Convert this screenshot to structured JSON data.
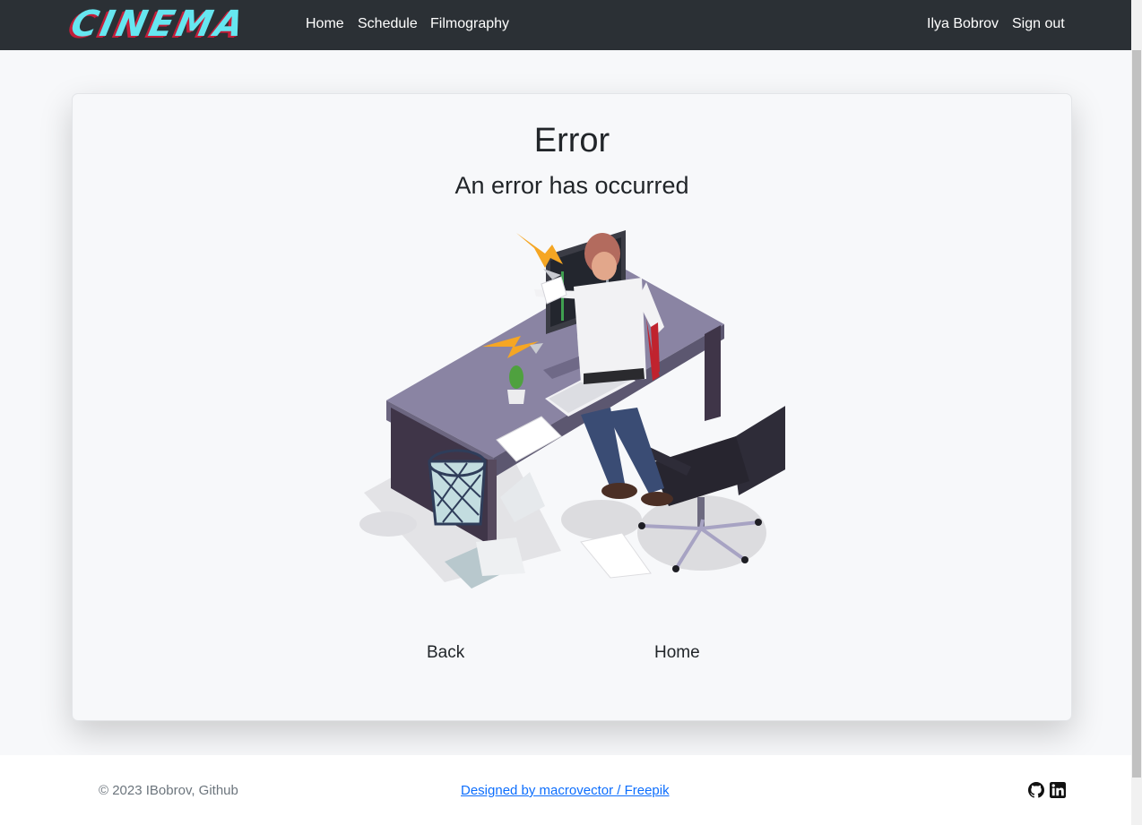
{
  "navbar": {
    "brand": "CINEMA",
    "links": [
      "Home",
      "Schedule",
      "Filmography"
    ],
    "user_name": "Ilya Bobrov",
    "sign_out": "Sign out"
  },
  "error": {
    "title": "Error",
    "message": "An error has occurred",
    "back_label": "Back",
    "home_label": "Home"
  },
  "footer": {
    "copyright": "© 2023 IBobrov, Github",
    "credit": "Designed by macrovector / Freepik",
    "icons": [
      "github-icon",
      "linkedin-icon"
    ]
  },
  "colors": {
    "navbar_bg": "#2b3035",
    "brand_cyan": "#66e6f0",
    "brand_red": "#c21e3a",
    "link_blue": "#0d6efd"
  }
}
